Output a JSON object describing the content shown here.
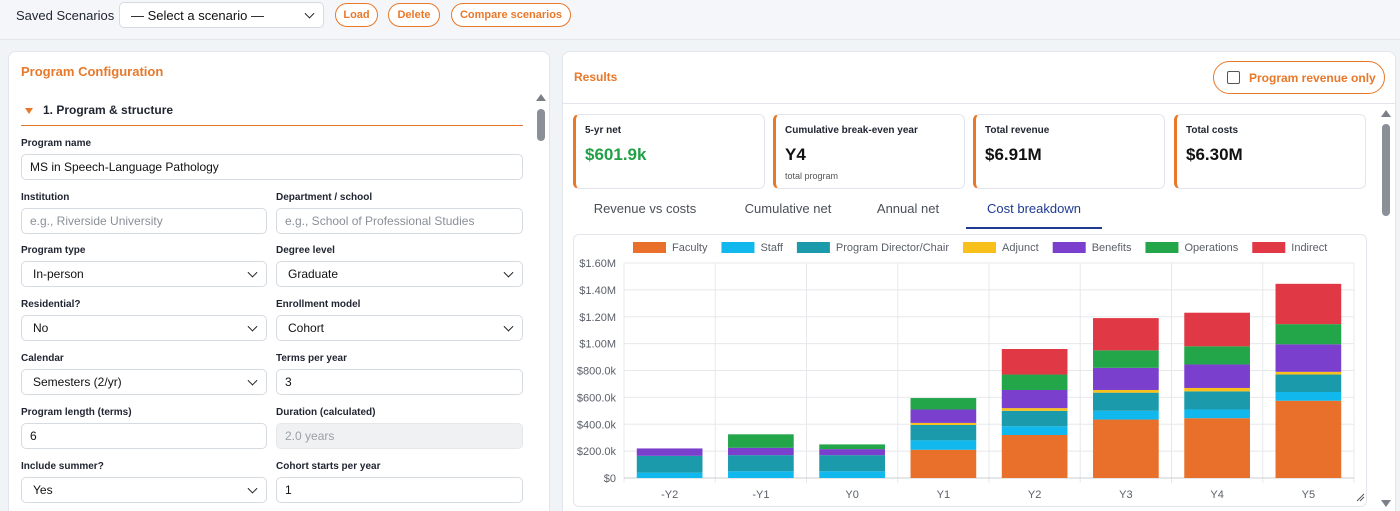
{
  "topbar": {
    "title": "Saved Scenarios",
    "scenario_select": "— Select a scenario —",
    "load_label": "Load",
    "delete_label": "Delete",
    "compare_label": "Compare scenarios"
  },
  "config": {
    "title": "Program Configuration",
    "section": "1. Program & structure",
    "fields": {
      "program_name": {
        "label": "Program name",
        "value": "MS in Speech-Language Pathology"
      },
      "institution": {
        "label": "Institution",
        "placeholder": "e.g., Riverside University"
      },
      "department": {
        "label": "Department / school",
        "placeholder": "e.g., School of Professional Studies"
      },
      "program_type": {
        "label": "Program type",
        "value": "In-person"
      },
      "degree_level": {
        "label": "Degree level",
        "value": "Graduate"
      },
      "residential": {
        "label": "Residential?",
        "value": "No"
      },
      "enrollment_model": {
        "label": "Enrollment model",
        "value": "Cohort"
      },
      "calendar": {
        "label": "Calendar",
        "value": "Semesters (2/yr)"
      },
      "terms_per_year": {
        "label": "Terms per year",
        "value": "3"
      },
      "program_length": {
        "label": "Program length (terms)",
        "value": "6"
      },
      "duration": {
        "label": "Duration (calculated)",
        "value": "2.0 years"
      },
      "include_summer": {
        "label": "Include summer?",
        "value": "Yes"
      },
      "cohort_starts": {
        "label": "Cohort starts per year",
        "value": "1"
      }
    }
  },
  "results": {
    "title": "Results",
    "toggle_label": "Program revenue only",
    "kpis": [
      {
        "label": "5-yr net",
        "value": "$601.9k",
        "sub": ""
      },
      {
        "label": "Cumulative break-even year",
        "value": "Y4",
        "sub": "total program"
      },
      {
        "label": "Total revenue",
        "value": "$6.91M",
        "sub": ""
      },
      {
        "label": "Total costs",
        "value": "$6.30M",
        "sub": ""
      }
    ],
    "tabs": [
      "Revenue vs costs",
      "Cumulative net",
      "Annual net",
      "Cost breakdown"
    ],
    "active_tab": "Cost breakdown"
  },
  "colors": {
    "accent": "#e8782a",
    "tab_active": "#1f3a93",
    "positive": "#22a045"
  },
  "chart_data": {
    "type": "bar",
    "stacked": true,
    "categories": [
      "-Y2",
      "-Y1",
      "Y0",
      "Y1",
      "Y2",
      "Y3",
      "Y4",
      "Y5"
    ],
    "ylim": [
      0,
      1600000
    ],
    "yticks": [
      0,
      200000,
      400000,
      600000,
      800000,
      1000000,
      1200000,
      1400000,
      1600000
    ],
    "ytick_labels": [
      "$0",
      "$200.0k",
      "$400.0k",
      "$600.0k",
      "$800.0k",
      "$1.00M",
      "$1.20M",
      "$1.40M",
      "$1.60M"
    ],
    "grid": true,
    "legend_position": "top",
    "series": [
      {
        "name": "Faculty",
        "color": "#e8702a",
        "values": [
          0,
          0,
          0,
          210000,
          320000,
          435000,
          445000,
          575000
        ]
      },
      {
        "name": "Staff",
        "color": "#11b8ee",
        "values": [
          40000,
          50000,
          50000,
          70000,
          65000,
          65000,
          65000,
          65000
        ]
      },
      {
        "name": "Program Director/Chair",
        "color": "#1a9aaa",
        "values": [
          125000,
          120000,
          120000,
          115000,
          115000,
          135000,
          135000,
          130000
        ]
      },
      {
        "name": "Adjunct",
        "color": "#f8c01a",
        "values": [
          0,
          0,
          0,
          15000,
          20000,
          20000,
          25000,
          20000
        ]
      },
      {
        "name": "Benefits",
        "color": "#7a3fcc",
        "values": [
          55000,
          55000,
          45000,
          100000,
          135000,
          165000,
          175000,
          205000
        ]
      },
      {
        "name": "Operations",
        "color": "#23a54a",
        "values": [
          0,
          100000,
          35000,
          85000,
          115000,
          130000,
          135000,
          150000
        ]
      },
      {
        "name": "Indirect",
        "color": "#e03844",
        "values": [
          0,
          0,
          0,
          0,
          190000,
          240000,
          250000,
          300000
        ]
      }
    ]
  }
}
